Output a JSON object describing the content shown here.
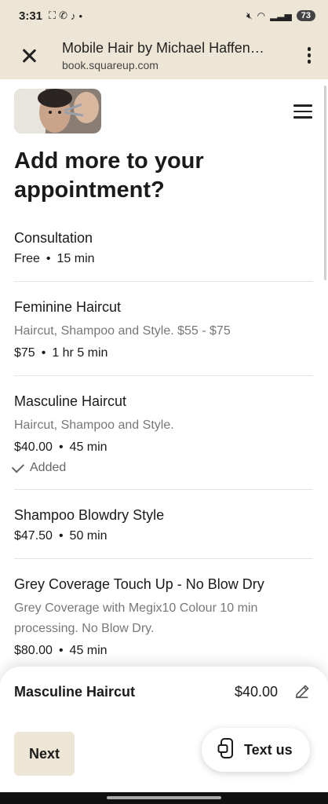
{
  "status_bar": {
    "time": "3:31",
    "battery": "73"
  },
  "browser": {
    "title": "Mobile Hair by Michael Haffen…",
    "host": "book.squareup.com"
  },
  "page": {
    "heading": "Add more to your appointment?",
    "services": [
      {
        "name": "Consultation",
        "desc": "",
        "price": "Free",
        "duration": "15 min",
        "added": ""
      },
      {
        "name": "Feminine Haircut",
        "desc": "Haircut, Shampoo and Style. $55 - $75",
        "price": "$75",
        "duration": "1 hr 5 min",
        "added": ""
      },
      {
        "name": "Masculine Haircut",
        "desc": "Haircut, Shampoo and Style.",
        "price": "$40.00",
        "duration": "45 min",
        "added": "Added"
      },
      {
        "name": "Shampoo Blowdry Style",
        "desc": "",
        "price": "$47.50",
        "duration": "50 min",
        "added": ""
      },
      {
        "name": "Grey Coverage Touch Up - No Blow Dry",
        "desc": "Grey Coverage with Megix10 Colour 10 min processing. No Blow Dry.",
        "price": "$80.00",
        "duration": "45 min",
        "added": ""
      }
    ]
  },
  "sheet": {
    "selected_name": "Masculine Haircut",
    "selected_price": "$40.00",
    "next_label": "Next",
    "text_us_label": "Text us"
  },
  "colors": {
    "chrome_bg": "#ede6d6",
    "next_bg": "#ede6d6"
  }
}
